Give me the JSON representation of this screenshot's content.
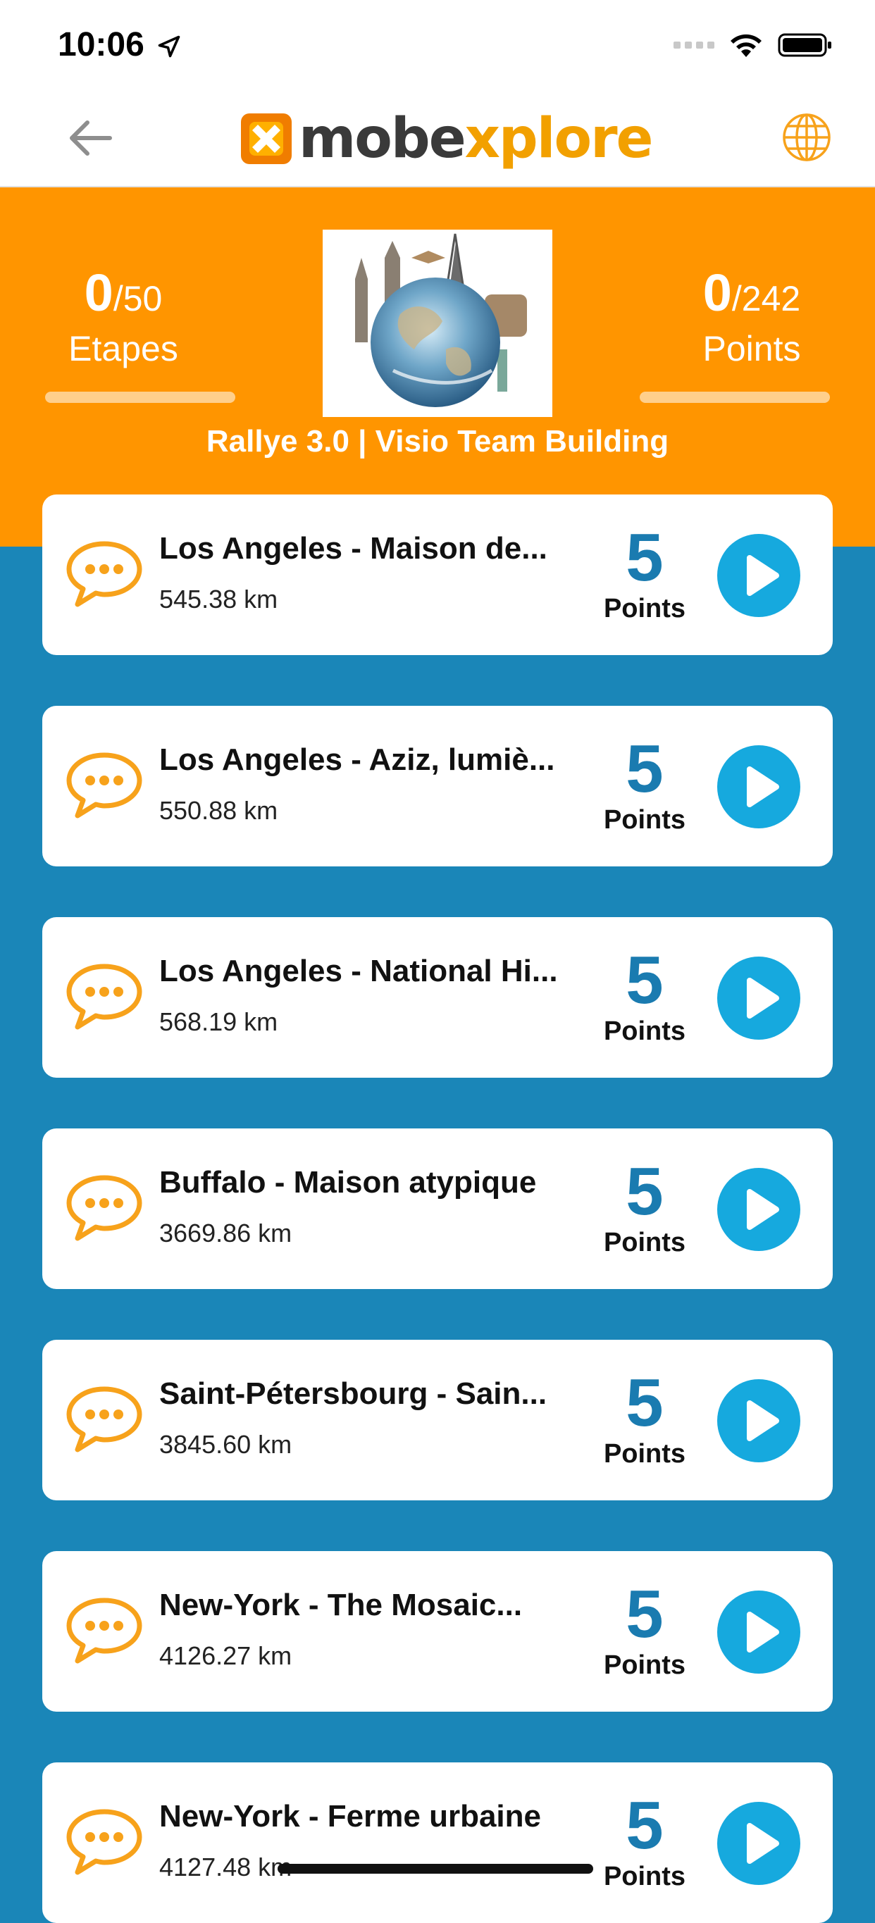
{
  "status_bar": {
    "time": "10:06"
  },
  "nav": {
    "logo_text_1": "mobe",
    "logo_text_x": "x",
    "logo_text_2": "plore"
  },
  "header": {
    "etapes_value": "0",
    "etapes_total": "/50",
    "etapes_label": "Etapes",
    "etapes_progress": 0,
    "points_value": "0",
    "points_total": "/242",
    "points_label": "Points",
    "points_progress": 0,
    "rally_title": "Rallye 3.0 | Visio Team Building"
  },
  "colors": {
    "header_orange": "#ff9500",
    "list_background": "#1a86b8",
    "points_blue": "#1a7bb0",
    "play_button": "#16a9de",
    "chat_icon_orange": "#f7a21b"
  },
  "icons": {
    "back": "arrow-left-icon",
    "globe": "globe-icon",
    "item": "chat-bubble-icon",
    "play": "play-icon"
  },
  "items": [
    {
      "title": "Los Angeles - Maison de...",
      "distance": "545.38 km",
      "points": "5",
      "points_label": "Points"
    },
    {
      "title": "Los Angeles - Aziz, lumiè...",
      "distance": "550.88 km",
      "points": "5",
      "points_label": "Points"
    },
    {
      "title": "Los Angeles - National Hi...",
      "distance": "568.19 km",
      "points": "5",
      "points_label": "Points"
    },
    {
      "title": "Buffalo - Maison atypique",
      "distance": "3669.86 km",
      "points": "5",
      "points_label": "Points"
    },
    {
      "title": "Saint-Pétersbourg - Sain...",
      "distance": "3845.60 km",
      "points": "5",
      "points_label": "Points"
    },
    {
      "title": "New-York - The Mosaic...",
      "distance": "4126.27 km",
      "points": "5",
      "points_label": "Points"
    },
    {
      "title": "New-York - Ferme urbaine",
      "distance": "4127.48 km",
      "points": "5",
      "points_label": "Points"
    }
  ]
}
